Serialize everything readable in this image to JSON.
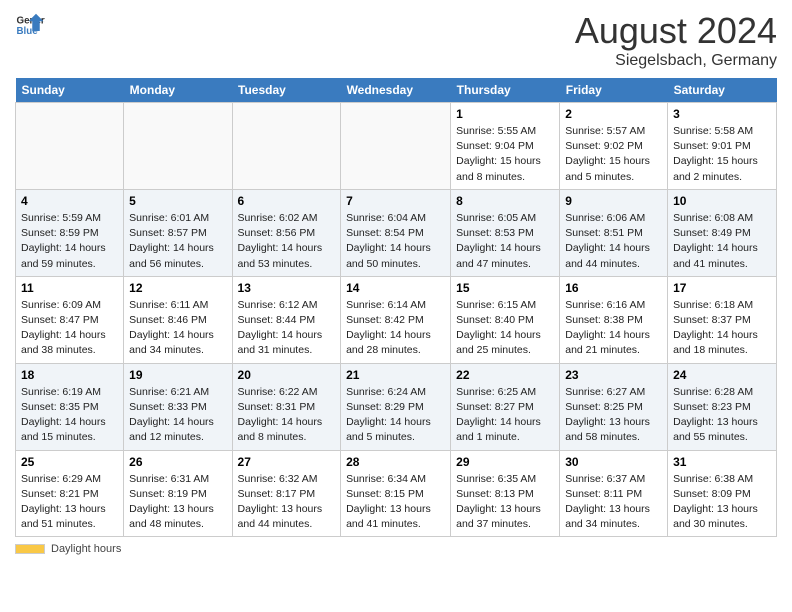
{
  "logo": {
    "line1": "General",
    "line2": "Blue"
  },
  "title": "August 2024",
  "subtitle": "Siegelsbach, Germany",
  "days_of_week": [
    "Sunday",
    "Monday",
    "Tuesday",
    "Wednesday",
    "Thursday",
    "Friday",
    "Saturday"
  ],
  "weeks": [
    [
      {
        "day": "",
        "detail": ""
      },
      {
        "day": "",
        "detail": ""
      },
      {
        "day": "",
        "detail": ""
      },
      {
        "day": "",
        "detail": ""
      },
      {
        "day": "1",
        "detail": "Sunrise: 5:55 AM\nSunset: 9:04 PM\nDaylight: 15 hours and 8 minutes."
      },
      {
        "day": "2",
        "detail": "Sunrise: 5:57 AM\nSunset: 9:02 PM\nDaylight: 15 hours and 5 minutes."
      },
      {
        "day": "3",
        "detail": "Sunrise: 5:58 AM\nSunset: 9:01 PM\nDaylight: 15 hours and 2 minutes."
      }
    ],
    [
      {
        "day": "4",
        "detail": "Sunrise: 5:59 AM\nSunset: 8:59 PM\nDaylight: 14 hours and 59 minutes."
      },
      {
        "day": "5",
        "detail": "Sunrise: 6:01 AM\nSunset: 8:57 PM\nDaylight: 14 hours and 56 minutes."
      },
      {
        "day": "6",
        "detail": "Sunrise: 6:02 AM\nSunset: 8:56 PM\nDaylight: 14 hours and 53 minutes."
      },
      {
        "day": "7",
        "detail": "Sunrise: 6:04 AM\nSunset: 8:54 PM\nDaylight: 14 hours and 50 minutes."
      },
      {
        "day": "8",
        "detail": "Sunrise: 6:05 AM\nSunset: 8:53 PM\nDaylight: 14 hours and 47 minutes."
      },
      {
        "day": "9",
        "detail": "Sunrise: 6:06 AM\nSunset: 8:51 PM\nDaylight: 14 hours and 44 minutes."
      },
      {
        "day": "10",
        "detail": "Sunrise: 6:08 AM\nSunset: 8:49 PM\nDaylight: 14 hours and 41 minutes."
      }
    ],
    [
      {
        "day": "11",
        "detail": "Sunrise: 6:09 AM\nSunset: 8:47 PM\nDaylight: 14 hours and 38 minutes."
      },
      {
        "day": "12",
        "detail": "Sunrise: 6:11 AM\nSunset: 8:46 PM\nDaylight: 14 hours and 34 minutes."
      },
      {
        "day": "13",
        "detail": "Sunrise: 6:12 AM\nSunset: 8:44 PM\nDaylight: 14 hours and 31 minutes."
      },
      {
        "day": "14",
        "detail": "Sunrise: 6:14 AM\nSunset: 8:42 PM\nDaylight: 14 hours and 28 minutes."
      },
      {
        "day": "15",
        "detail": "Sunrise: 6:15 AM\nSunset: 8:40 PM\nDaylight: 14 hours and 25 minutes."
      },
      {
        "day": "16",
        "detail": "Sunrise: 6:16 AM\nSunset: 8:38 PM\nDaylight: 14 hours and 21 minutes."
      },
      {
        "day": "17",
        "detail": "Sunrise: 6:18 AM\nSunset: 8:37 PM\nDaylight: 14 hours and 18 minutes."
      }
    ],
    [
      {
        "day": "18",
        "detail": "Sunrise: 6:19 AM\nSunset: 8:35 PM\nDaylight: 14 hours and 15 minutes."
      },
      {
        "day": "19",
        "detail": "Sunrise: 6:21 AM\nSunset: 8:33 PM\nDaylight: 14 hours and 12 minutes."
      },
      {
        "day": "20",
        "detail": "Sunrise: 6:22 AM\nSunset: 8:31 PM\nDaylight: 14 hours and 8 minutes."
      },
      {
        "day": "21",
        "detail": "Sunrise: 6:24 AM\nSunset: 8:29 PM\nDaylight: 14 hours and 5 minutes."
      },
      {
        "day": "22",
        "detail": "Sunrise: 6:25 AM\nSunset: 8:27 PM\nDaylight: 14 hours and 1 minute."
      },
      {
        "day": "23",
        "detail": "Sunrise: 6:27 AM\nSunset: 8:25 PM\nDaylight: 13 hours and 58 minutes."
      },
      {
        "day": "24",
        "detail": "Sunrise: 6:28 AM\nSunset: 8:23 PM\nDaylight: 13 hours and 55 minutes."
      }
    ],
    [
      {
        "day": "25",
        "detail": "Sunrise: 6:29 AM\nSunset: 8:21 PM\nDaylight: 13 hours and 51 minutes."
      },
      {
        "day": "26",
        "detail": "Sunrise: 6:31 AM\nSunset: 8:19 PM\nDaylight: 13 hours and 48 minutes."
      },
      {
        "day": "27",
        "detail": "Sunrise: 6:32 AM\nSunset: 8:17 PM\nDaylight: 13 hours and 44 minutes."
      },
      {
        "day": "28",
        "detail": "Sunrise: 6:34 AM\nSunset: 8:15 PM\nDaylight: 13 hours and 41 minutes."
      },
      {
        "day": "29",
        "detail": "Sunrise: 6:35 AM\nSunset: 8:13 PM\nDaylight: 13 hours and 37 minutes."
      },
      {
        "day": "30",
        "detail": "Sunrise: 6:37 AM\nSunset: 8:11 PM\nDaylight: 13 hours and 34 minutes."
      },
      {
        "day": "31",
        "detail": "Sunrise: 6:38 AM\nSunset: 8:09 PM\nDaylight: 13 hours and 30 minutes."
      }
    ]
  ],
  "footer": {
    "label": "Daylight hours"
  }
}
